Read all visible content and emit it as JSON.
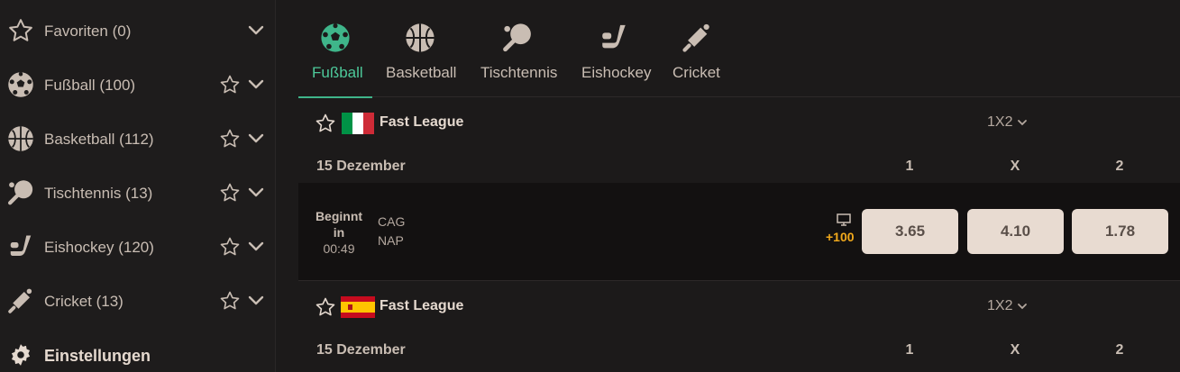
{
  "sidebar": {
    "items": [
      {
        "label": "Favoriten (0)",
        "icon": "star-outline-icon",
        "has_star": false
      },
      {
        "label": "Fußball (100)",
        "icon": "soccer-ball-icon",
        "has_star": true
      },
      {
        "label": "Basketball (112)",
        "icon": "basketball-icon",
        "has_star": true
      },
      {
        "label": "Tischtennis (13)",
        "icon": "table-tennis-icon",
        "has_star": true
      },
      {
        "label": "Eishockey (120)",
        "icon": "hockey-icon",
        "has_star": true
      },
      {
        "label": "Cricket (13)",
        "icon": "cricket-icon",
        "has_star": true
      }
    ],
    "settings_label": "Einstellungen"
  },
  "tabs": [
    {
      "label": "Fußball",
      "icon": "soccer-ball-icon",
      "active": true
    },
    {
      "label": "Basketball",
      "icon": "basketball-icon",
      "active": false
    },
    {
      "label": "Tischtennis",
      "icon": "table-tennis-icon",
      "active": false
    },
    {
      "label": "Eishockey",
      "icon": "hockey-icon",
      "active": false
    },
    {
      "label": "Cricket",
      "icon": "cricket-icon",
      "active": false
    }
  ],
  "leagues": [
    {
      "title": "Fast League",
      "flag": "italy-flag",
      "market": "1X2",
      "date": "15 Dezember",
      "headers": [
        "1",
        "X",
        "2"
      ],
      "event": {
        "status_line1": "Beginnt",
        "status_line2": "in",
        "time": "00:49",
        "home": "CAG",
        "away": "NAP",
        "more_markets": "+100",
        "odds": [
          "3.65",
          "4.10",
          "1.78"
        ]
      }
    },
    {
      "title": "Fast League",
      "flag": "spain-flag",
      "market": "1X2",
      "date": "15 Dezember",
      "headers": [
        "1",
        "X",
        "2"
      ]
    }
  ],
  "colors": {
    "accent": "#3fb58a",
    "odds_bg": "#e8dbd1",
    "plus_color": "#f1a91c",
    "background": "#1c1a1a"
  }
}
